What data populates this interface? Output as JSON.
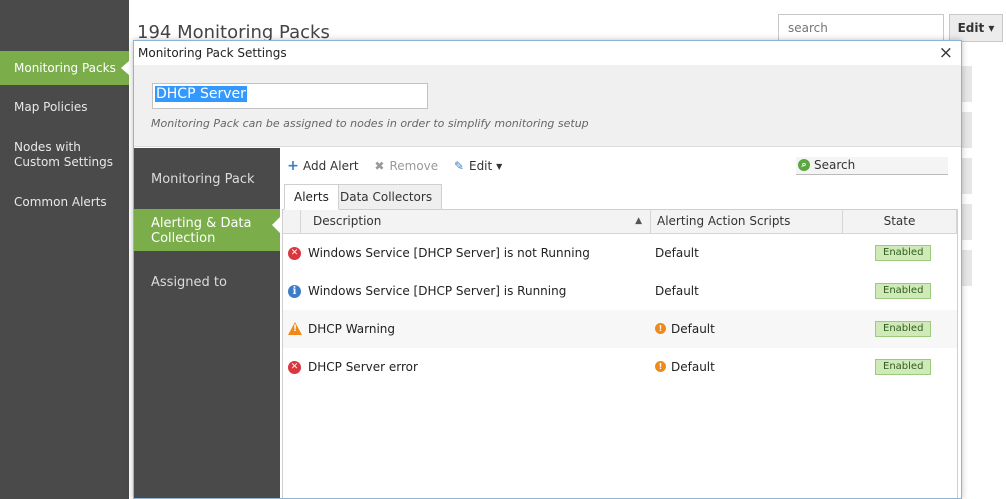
{
  "sidebar": {
    "items": [
      {
        "label": "Monitoring Packs"
      },
      {
        "label": "Map Policies"
      },
      {
        "label": "Nodes with Custom Settings"
      },
      {
        "label": "Common Alerts"
      }
    ]
  },
  "page": {
    "title": "194 Monitoring Packs",
    "search_placeholder": "search",
    "edit_label": "Edit ▾"
  },
  "modal": {
    "title": "Monitoring Pack Settings",
    "close_glyph": "×",
    "name_value": "DHCP Server",
    "hint": "Monitoring Pack can be assigned to nodes in order to simplify monitoring setup",
    "nav": [
      {
        "label": "Monitoring Pack"
      },
      {
        "label": "Alerting & Data Collection"
      },
      {
        "label": "Assigned to"
      }
    ],
    "toolbar": {
      "add_label": "Add Alert",
      "remove_label": "Remove",
      "edit_label": "Edit",
      "search_label": "Search"
    },
    "tabs": [
      {
        "label": "Alerts"
      },
      {
        "label": "Data Collectors"
      }
    ],
    "columns": [
      "Description",
      "Alerting Action Scripts",
      "State"
    ],
    "rows": [
      {
        "severity": "error",
        "description": "Windows Service [DHCP Server] is not Running",
        "script": "Default",
        "script_warning": false,
        "state": "Enabled"
      },
      {
        "severity": "info",
        "description": "Windows Service [DHCP Server] is Running",
        "script": "Default",
        "script_warning": false,
        "state": "Enabled"
      },
      {
        "severity": "warning",
        "description": "DHCP Warning",
        "script": "Default",
        "script_warning": true,
        "state": "Enabled"
      },
      {
        "severity": "error",
        "description": "DHCP Server error",
        "script": "Default",
        "script_warning": true,
        "state": "Enabled"
      }
    ]
  },
  "colors": {
    "accent_green": "#7bae4a",
    "sidebar_dark": "#4a4a4a",
    "error_red": "#d9363e",
    "info_blue": "#3b7dc9",
    "warning_orange": "#ef8a1a"
  }
}
